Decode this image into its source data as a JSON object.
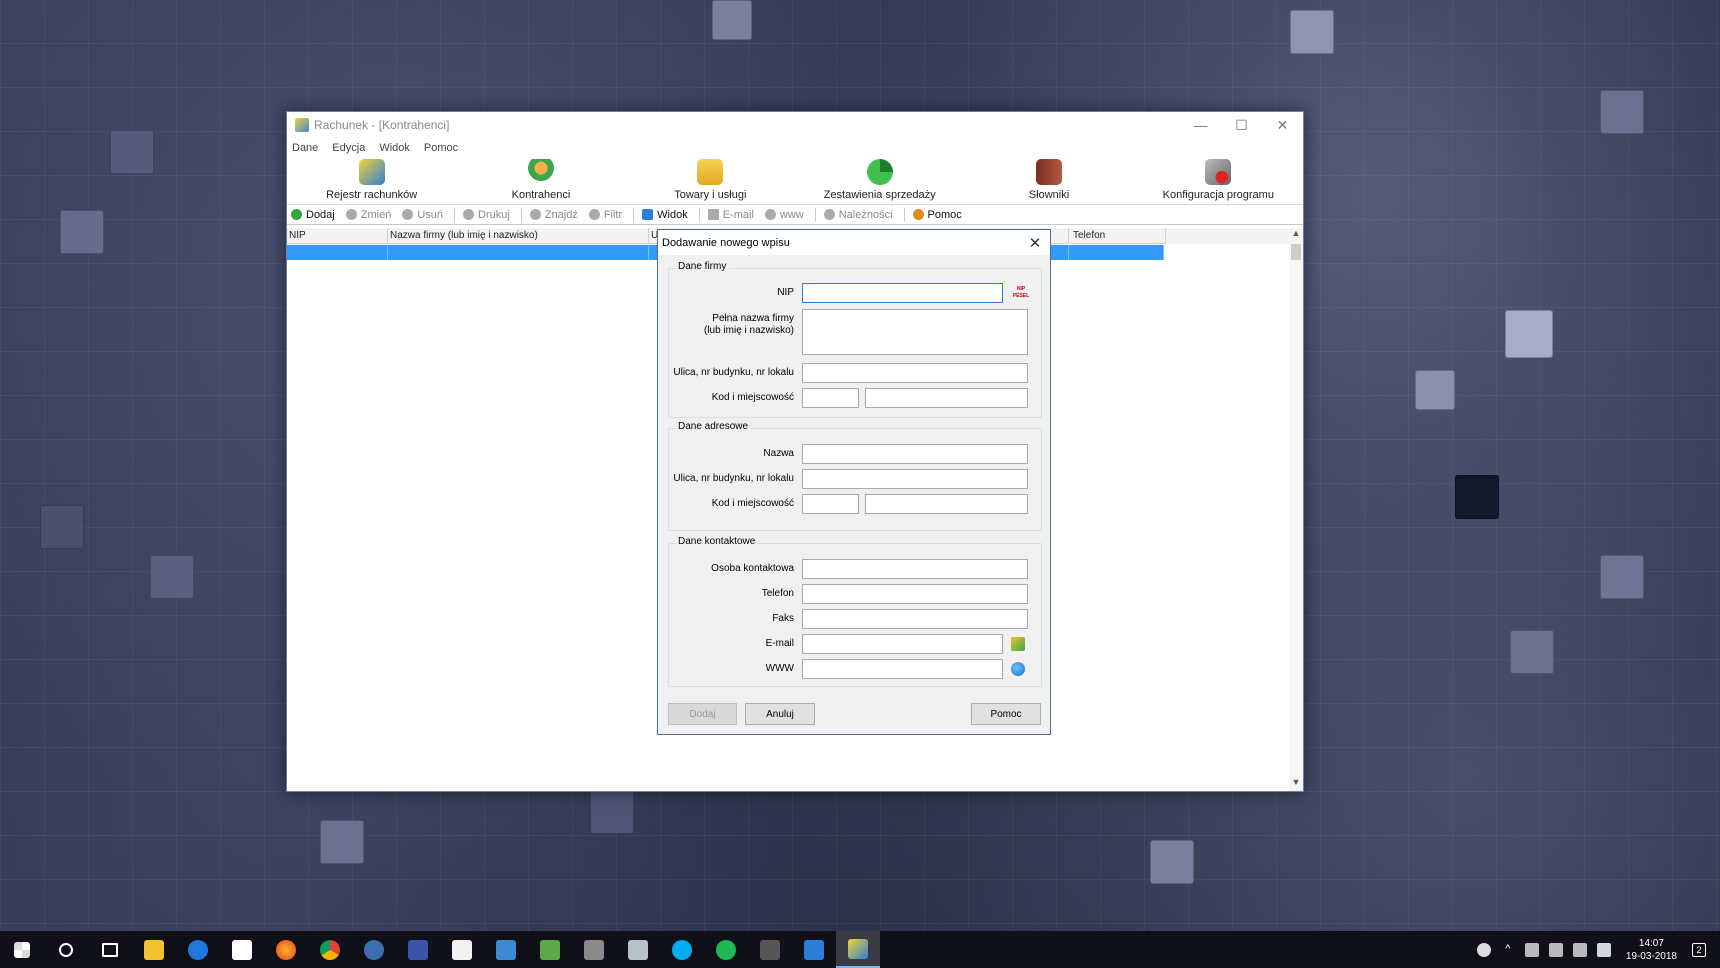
{
  "window": {
    "title": "Rachunek - [Kontrahenci]",
    "controls": {
      "minimize": "—",
      "maximize": "☐",
      "close": "✕"
    }
  },
  "menu": [
    "Dane",
    "Edycja",
    "Widok",
    "Pomoc"
  ],
  "big_toolbar": [
    {
      "label": "Rejestr rachunków",
      "icon": "receipts-register-icon",
      "color": "#2f7fd4"
    },
    {
      "label": "Kontrahenci",
      "icon": "contacts-icon",
      "color": "#e0a02a"
    },
    {
      "label": "Towary i usługi",
      "icon": "folder-icon",
      "color": "#f2c12e"
    },
    {
      "label": "Zestawienia sprzedaży",
      "icon": "pie-chart-icon",
      "color": "#2ea83a"
    },
    {
      "label": "Słowniki",
      "icon": "book-icon",
      "color": "#a04a3a"
    },
    {
      "label": "Konfiguracja programu",
      "icon": "tools-icon",
      "color": "#777777"
    }
  ],
  "small_toolbar": [
    {
      "label": "Dodaj",
      "icon": "add-icon",
      "active": true,
      "color": "#2ea83a"
    },
    {
      "label": "Zmień",
      "icon": "edit-icon",
      "active": false,
      "color": "#aaaaaa"
    },
    {
      "label": "Usuń",
      "icon": "delete-icon",
      "active": false,
      "color": "#aaaaaa"
    },
    {
      "label": "Drukuj",
      "icon": "print-icon",
      "active": false,
      "color": "#aaaaaa"
    },
    {
      "label": "Znajdź",
      "icon": "search-icon",
      "active": false,
      "color": "#aaaaaa"
    },
    {
      "label": "Filtr",
      "icon": "filter-icon",
      "active": false,
      "color": "#aaaaaa"
    },
    {
      "label": "Widok",
      "icon": "view-icon",
      "active": true,
      "color": "#2b7fd9"
    },
    {
      "label": "E-mail",
      "icon": "email-icon",
      "active": false,
      "color": "#aaaaaa"
    },
    {
      "label": "www",
      "icon": "globe-icon",
      "active": false,
      "color": "#aaaaaa"
    },
    {
      "label": "Należności",
      "icon": "receivables-icon",
      "active": false,
      "color": "#aaaaaa"
    },
    {
      "label": "Pomoc",
      "icon": "help-icon",
      "active": true,
      "color": "#e08a1e"
    }
  ],
  "grid": {
    "columns": [
      "NIP",
      "Nazwa firmy (lub imię i nazwisko)",
      "U",
      "",
      "Telefon"
    ]
  },
  "dialog": {
    "title": "Dodawanie nowego wpisu",
    "company_group": {
      "title": "Dane firmy",
      "nip_label": "NIP",
      "nip_value": "",
      "fullname_label_1": "Pełna nazwa firmy",
      "fullname_label_2": "(lub imię i nazwisko)",
      "street_label": "Ulica, nr budynku, nr lokalu",
      "postal_label": "Kod i miejscowość",
      "nip_pesel_icon_text": "NIP PESEL"
    },
    "address_group": {
      "title": "Dane adresowe",
      "name_label": "Nazwa",
      "street_label": "Ulica, nr budynku, nr lokalu",
      "postal_label": "Kod i miejscowość"
    },
    "contact_group": {
      "title": "Dane kontaktowe",
      "person_label": "Osoba kontaktowa",
      "phone_label": "Telefon",
      "fax_label": "Faks",
      "email_label": "E-mail",
      "www_label": "WWW"
    },
    "buttons": {
      "add": "Dodaj",
      "cancel": "Anuluj",
      "help": "Pomoc"
    }
  },
  "taskbar": {
    "apps": [
      "start-icon",
      "search-icon",
      "task-view-icon",
      "file-explorer-icon",
      "edge-icon",
      "store-icon",
      "firefox-icon",
      "chrome-icon",
      "thunderbird-icon",
      "save-app-icon",
      "paint-icon",
      "app-icon",
      "app2-icon",
      "app3-icon",
      "app4-icon",
      "skype-icon",
      "spotify-icon",
      "calculator-icon",
      "app5-icon",
      "rachunek-icon"
    ],
    "time": "14:07",
    "date": "19-03-2018",
    "notification_count": "2"
  }
}
